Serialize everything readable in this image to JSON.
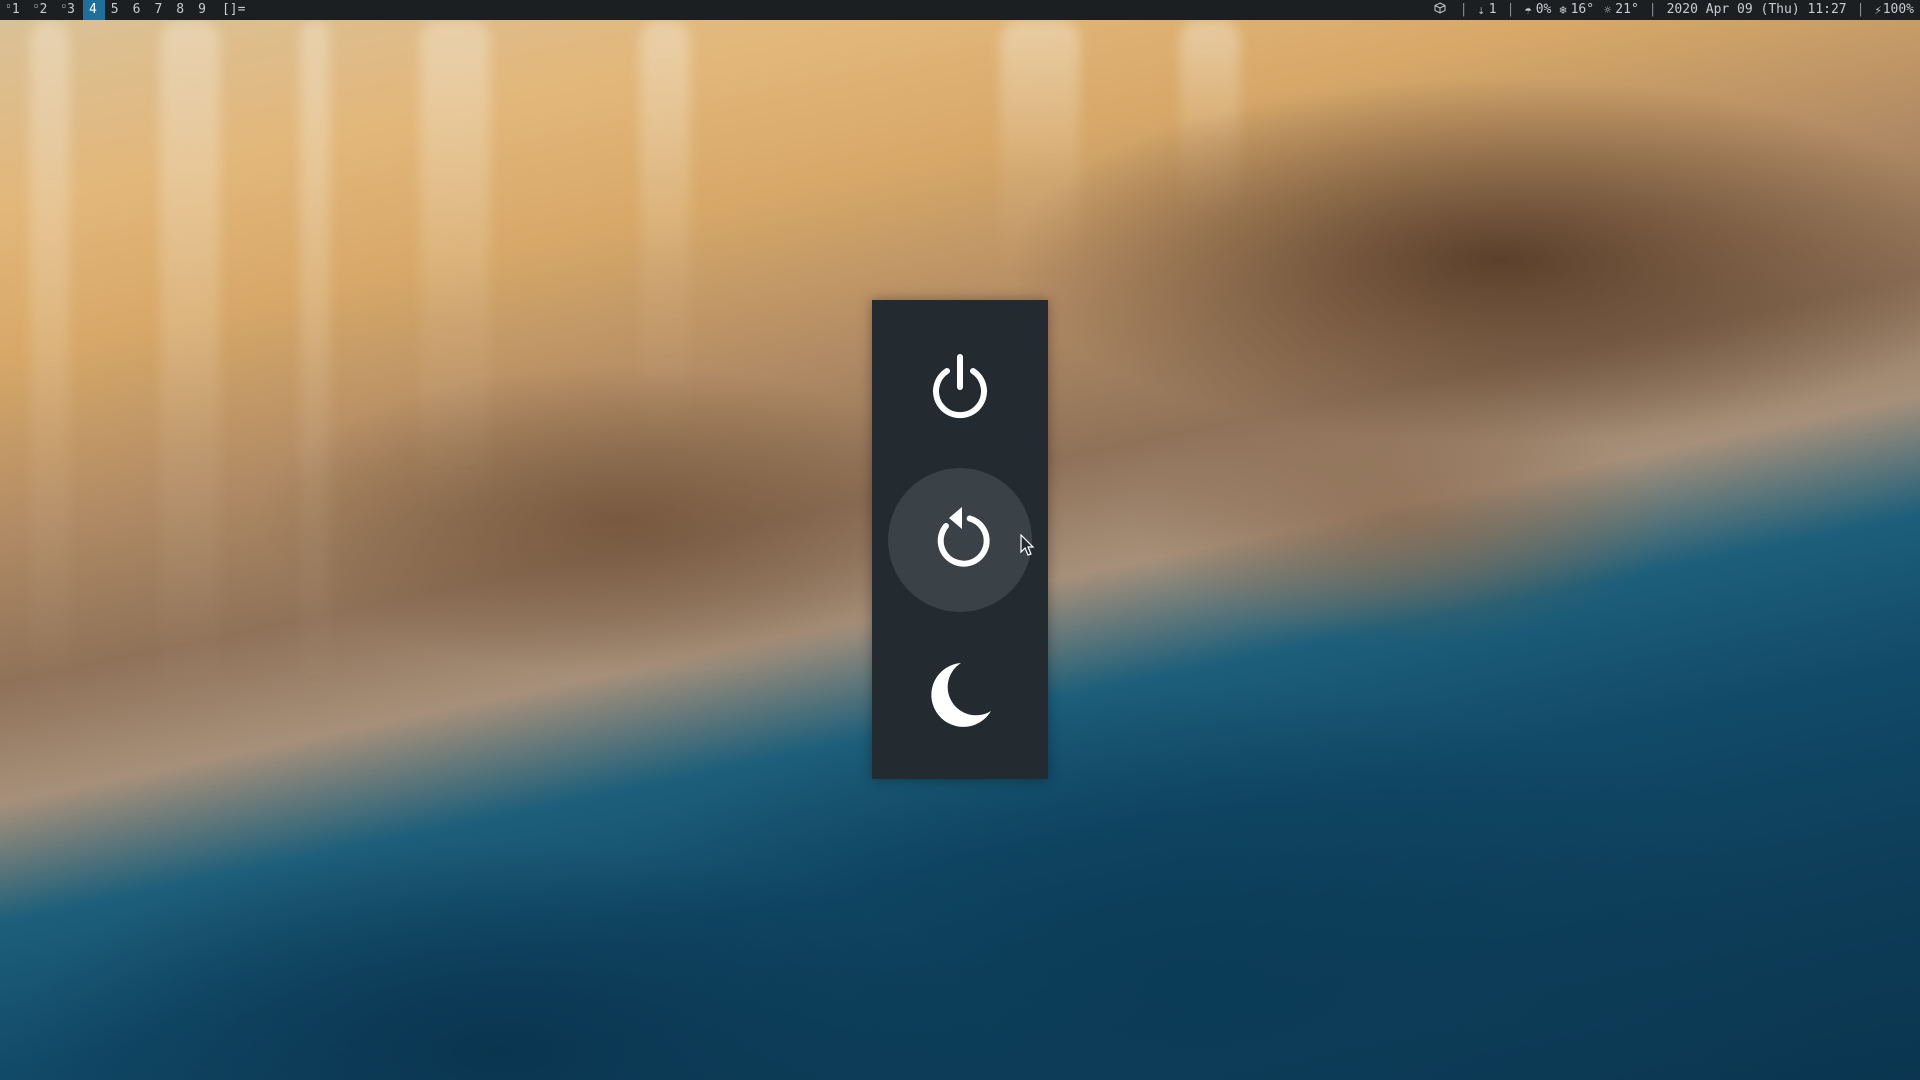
{
  "topbar": {
    "workspaces": [
      {
        "label": "1",
        "has_windows": true,
        "active": false
      },
      {
        "label": "2",
        "has_windows": true,
        "active": false
      },
      {
        "label": "3",
        "has_windows": true,
        "active": false
      },
      {
        "label": "4",
        "has_windows": false,
        "active": true
      },
      {
        "label": "5",
        "has_windows": false,
        "active": false
      },
      {
        "label": "6",
        "has_windows": false,
        "active": false
      },
      {
        "label": "7",
        "has_windows": false,
        "active": false
      },
      {
        "label": "8",
        "has_windows": false,
        "active": false
      },
      {
        "label": "9",
        "has_windows": false,
        "active": false
      }
    ],
    "layout_symbol": "[]=",
    "status": {
      "package_icon": "package-icon",
      "updates": "1",
      "updates_icon": "download-icon",
      "rain_icon": "umbrella-icon",
      "rain": "0%",
      "low_icon": "snowflake-icon",
      "low_temp": "16°",
      "high_icon": "sun-icon",
      "high_temp": "21°",
      "datetime": "2020 Apr 09 (Thu) 11:27",
      "battery_icon": "battery-charging-icon",
      "battery": "100%"
    }
  },
  "power_menu": {
    "items": [
      {
        "name": "shutdown",
        "icon": "power-icon",
        "hovered": false
      },
      {
        "name": "reboot",
        "icon": "restart-icon",
        "hovered": true
      },
      {
        "name": "sleep",
        "icon": "moon-icon",
        "hovered": false
      }
    ]
  },
  "colors": {
    "bar_bg": "#1b1f22",
    "active_workspace": "#1f6f9c",
    "menu_bg": "#232b31",
    "menu_hover": "#3a4247",
    "icon": "#ffffff"
  }
}
